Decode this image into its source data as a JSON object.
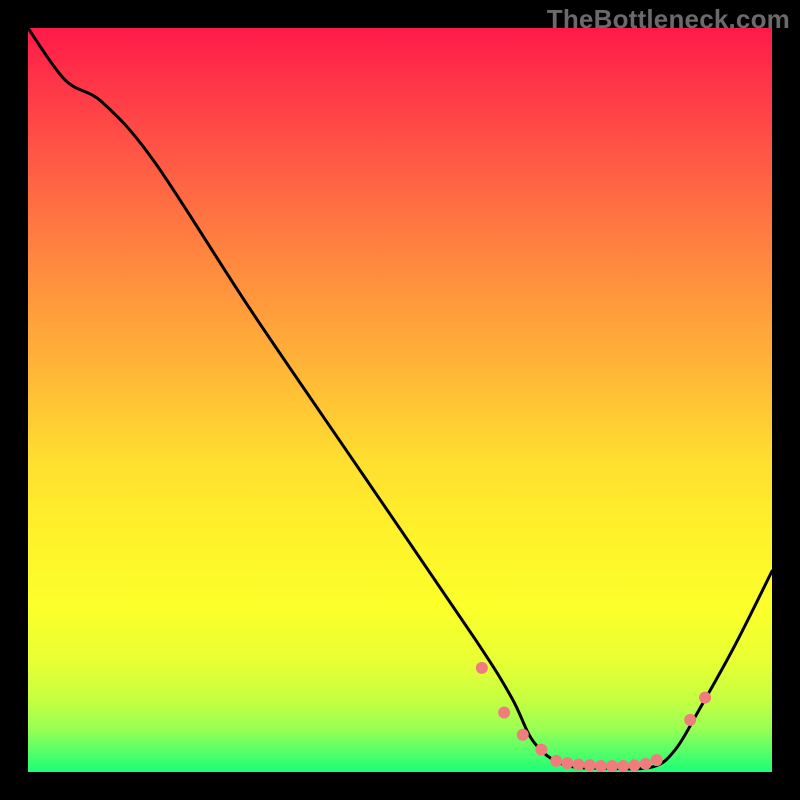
{
  "watermark": "TheBottleneck.com",
  "chart_data": {
    "type": "line",
    "title": "",
    "xlabel": "",
    "ylabel": "",
    "xlim": [
      0,
      100
    ],
    "ylim": [
      0,
      100
    ],
    "series": [
      {
        "name": "curve",
        "color": "#000000",
        "x": [
          0,
          5,
          10,
          17,
          30,
          45,
          60,
          65,
          68,
          72,
          78,
          84,
          87,
          90,
          95,
          100
        ],
        "y": [
          100,
          93,
          90,
          82,
          62,
          40,
          18,
          10,
          4,
          1,
          0.5,
          0.7,
          3,
          8,
          17,
          27
        ]
      }
    ],
    "markers": {
      "name": "dots",
      "color": "#f07d7d",
      "radius_px": 6,
      "x": [
        61,
        64,
        66.5,
        69,
        71,
        72.5,
        74,
        75.5,
        77,
        78.5,
        80,
        81.5,
        83,
        84.5,
        89,
        91
      ],
      "y": [
        14,
        8,
        5,
        3,
        1.5,
        1.2,
        1.0,
        0.9,
        0.8,
        0.8,
        0.8,
        0.9,
        1.1,
        1.6,
        7,
        10
      ]
    },
    "background_gradient": {
      "top": "#ff1a49",
      "bottom": "#1aff78"
    }
  }
}
